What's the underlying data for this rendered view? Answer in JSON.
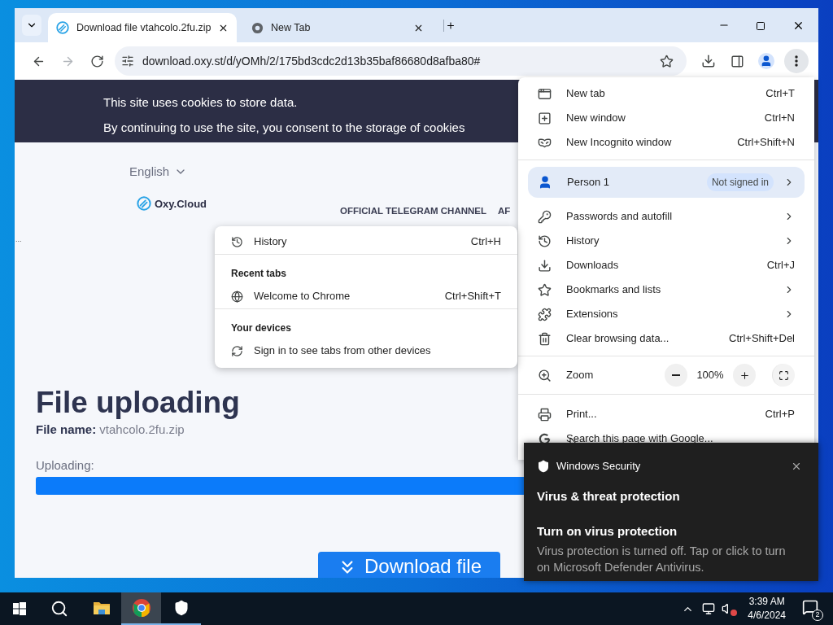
{
  "tabs": [
    {
      "title": "Download file vtahcolo.2fu.zip",
      "selected": true
    },
    {
      "title": "New Tab",
      "selected": false
    }
  ],
  "nav_buttons": [
    {
      "disabled": false
    },
    {
      "disabled": true
    },
    {
      "disabled": false
    }
  ],
  "address": "download.oxy.st/d/yOMh/2/175bd3cdc2d13b35baf86680d8afba80#",
  "page": {
    "cookie_lines": [
      "This site uses cookies to store data.",
      "By continuing to use the site, you consent to the storage of cookies"
    ],
    "language": "English",
    "logo": "Oxy.Cloud",
    "nav_links": [
      "OFFICIAL TELEGRAM CHANNEL",
      "AF"
    ],
    "ellipsis": "...",
    "heading": "File uploading",
    "file_label": "File name:",
    "file_name": "vtahcolo.2fu.zip",
    "progress_label": "Uploading:",
    "progress": {
      "level": 1
    },
    "download_button": "Download file"
  },
  "menu": {
    "sections": [
      [
        {
          "kind": "item",
          "label": "New tab",
          "shortcut": "Ctrl+T",
          "submenu": false
        },
        {
          "kind": "item",
          "label": "New window",
          "shortcut": "Ctrl+N",
          "submenu": false
        },
        {
          "kind": "item",
          "label": "New Incognito window",
          "shortcut": "Ctrl+Shift+N",
          "submenu": false
        }
      ],
      [
        {
          "kind": "profile",
          "label": "Person 1",
          "badge": "Not signed in",
          "submenu": true
        },
        {
          "kind": "item",
          "label": "Passwords and autofill",
          "submenu": true
        },
        {
          "kind": "item",
          "label": "History",
          "submenu": true
        },
        {
          "kind": "item",
          "label": "Downloads",
          "shortcut": "Ctrl+J",
          "submenu": false
        },
        {
          "kind": "item",
          "label": "Bookmarks and lists",
          "submenu": true
        },
        {
          "kind": "item",
          "label": "Extensions",
          "submenu": true
        },
        {
          "kind": "item",
          "label": "Clear browsing data...",
          "shortcut": "Ctrl+Shift+Del",
          "submenu": false
        }
      ],
      [
        {
          "kind": "zoom",
          "label": "Zoom",
          "value": "100%"
        }
      ],
      [
        {
          "kind": "item",
          "label": "Print...",
          "shortcut": "Ctrl+P",
          "submenu": false
        },
        {
          "kind": "item",
          "label": "Search this page with Google...",
          "submenu": false
        }
      ]
    ]
  },
  "history_submenu": {
    "sections": [
      {
        "items": [
          {
            "label": "History",
            "shortcut": "Ctrl+H"
          }
        ]
      },
      {
        "title": "Recent tabs",
        "items": [
          {
            "label": "Welcome to Chrome",
            "shortcut": "Ctrl+Shift+T"
          }
        ]
      },
      {
        "title": "Your devices",
        "items": [
          {
            "label": "Sign in to see tabs from other devices"
          }
        ]
      }
    ]
  },
  "toast": {
    "app": "Windows Security",
    "title": "Virus & threat protection",
    "heading": "Turn on virus protection",
    "body": "Virus protection is turned off. Tap or click to turn on Microsoft Defender Antivirus."
  },
  "taskbar": {
    "apps": [
      {
        "running": false,
        "active": false
      },
      {
        "running": true,
        "active": true
      },
      {
        "running": true,
        "active": false
      }
    ],
    "time": "3:39 AM",
    "date": "4/6/2024",
    "notifications": "2"
  }
}
